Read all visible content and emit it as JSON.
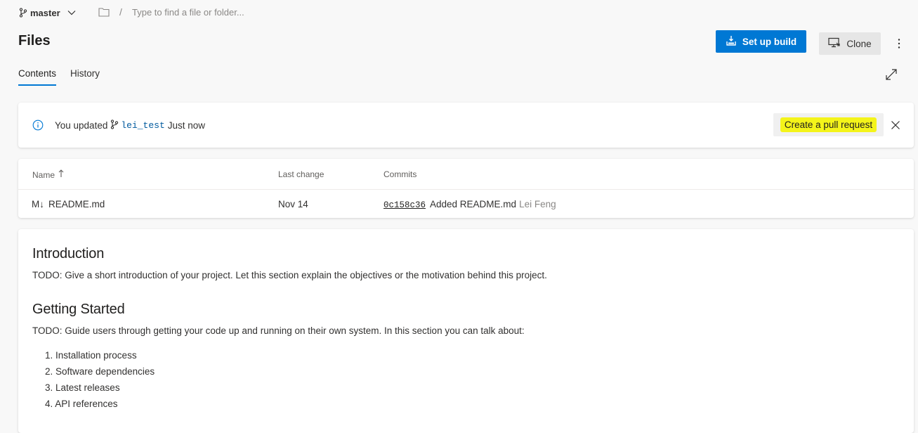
{
  "topbar": {
    "branch": "master",
    "path_placeholder": "Type to find a file or folder...",
    "path_separator": "/"
  },
  "header": {
    "title": "Files",
    "setup_build_label": "Set up build",
    "clone_label": "Clone"
  },
  "tabs": [
    {
      "label": "Contents",
      "active": true
    },
    {
      "label": "History",
      "active": false
    }
  ],
  "banner": {
    "prefix": "You updated",
    "branch": "lei_test",
    "suffix": "Just now",
    "pr_button": "Create a pull request"
  },
  "files": {
    "columns": {
      "name": "Name",
      "last_change": "Last change",
      "commits": "Commits"
    },
    "rows": [
      {
        "icon": "M↓",
        "name": "README.md",
        "last_change": "Nov 14",
        "commit_hash": "0c158c36",
        "commit_message": "Added README.md",
        "author": "Lei Feng"
      }
    ]
  },
  "readme": {
    "h1": "Introduction",
    "p1": "TODO: Give a short introduction of your project. Let this section explain the objectives or the motivation behind this project.",
    "h2": "Getting Started",
    "p2": "TODO: Guide users through getting your code up and running on their own system. In this section you can talk about:",
    "list": [
      "1. Installation process",
      "2. Software dependencies",
      "3. Latest releases",
      "4. API references"
    ]
  },
  "colors": {
    "primary": "#0078d4",
    "highlight": "#f4f41a",
    "background": "#f8f8f8"
  }
}
